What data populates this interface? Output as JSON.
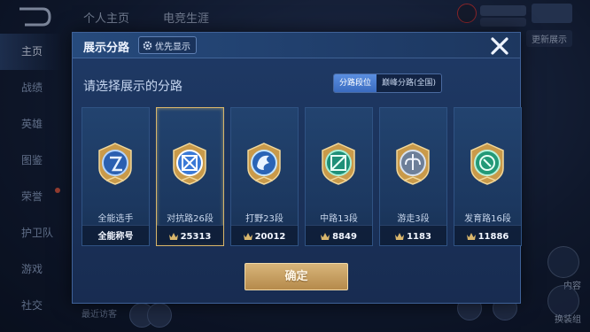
{
  "background": {
    "tabs": [
      "个人主页",
      "电竞生涯"
    ],
    "sidebar": [
      "主页",
      "战绩",
      "英雄",
      "图鉴",
      "荣誉",
      "护卫队",
      "游戏",
      "社交"
    ],
    "recent": "最近访客",
    "right_labels": [
      "内容",
      "换装组"
    ],
    "update_label": "更新展示"
  },
  "modal": {
    "title": "展示分路",
    "priority_label": "优先显示",
    "prompt": "请选择展示的分路",
    "toggle": {
      "left": "分路段位",
      "right": "巅峰分路(全国)"
    },
    "confirm_label": "确定",
    "accent": "#d8b66a",
    "cards": [
      {
        "name": "全能选手",
        "value": "全能称号",
        "icon": "all-round-badge-icon",
        "crown": false,
        "selected": false
      },
      {
        "name": "对抗路26段",
        "value": "25313",
        "icon": "clash-lane-badge-icon",
        "crown": true,
        "selected": true
      },
      {
        "name": "打野23段",
        "value": "20012",
        "icon": "jungle-badge-icon",
        "crown": true,
        "selected": false
      },
      {
        "name": "中路13段",
        "value": "8849",
        "icon": "mid-lane-badge-icon",
        "crown": true,
        "selected": false
      },
      {
        "name": "游走3段",
        "value": "1183",
        "icon": "roam-badge-icon",
        "crown": true,
        "selected": false
      },
      {
        "name": "发育路16段",
        "value": "11886",
        "icon": "farm-lane-badge-icon",
        "crown": true,
        "selected": false
      }
    ]
  }
}
